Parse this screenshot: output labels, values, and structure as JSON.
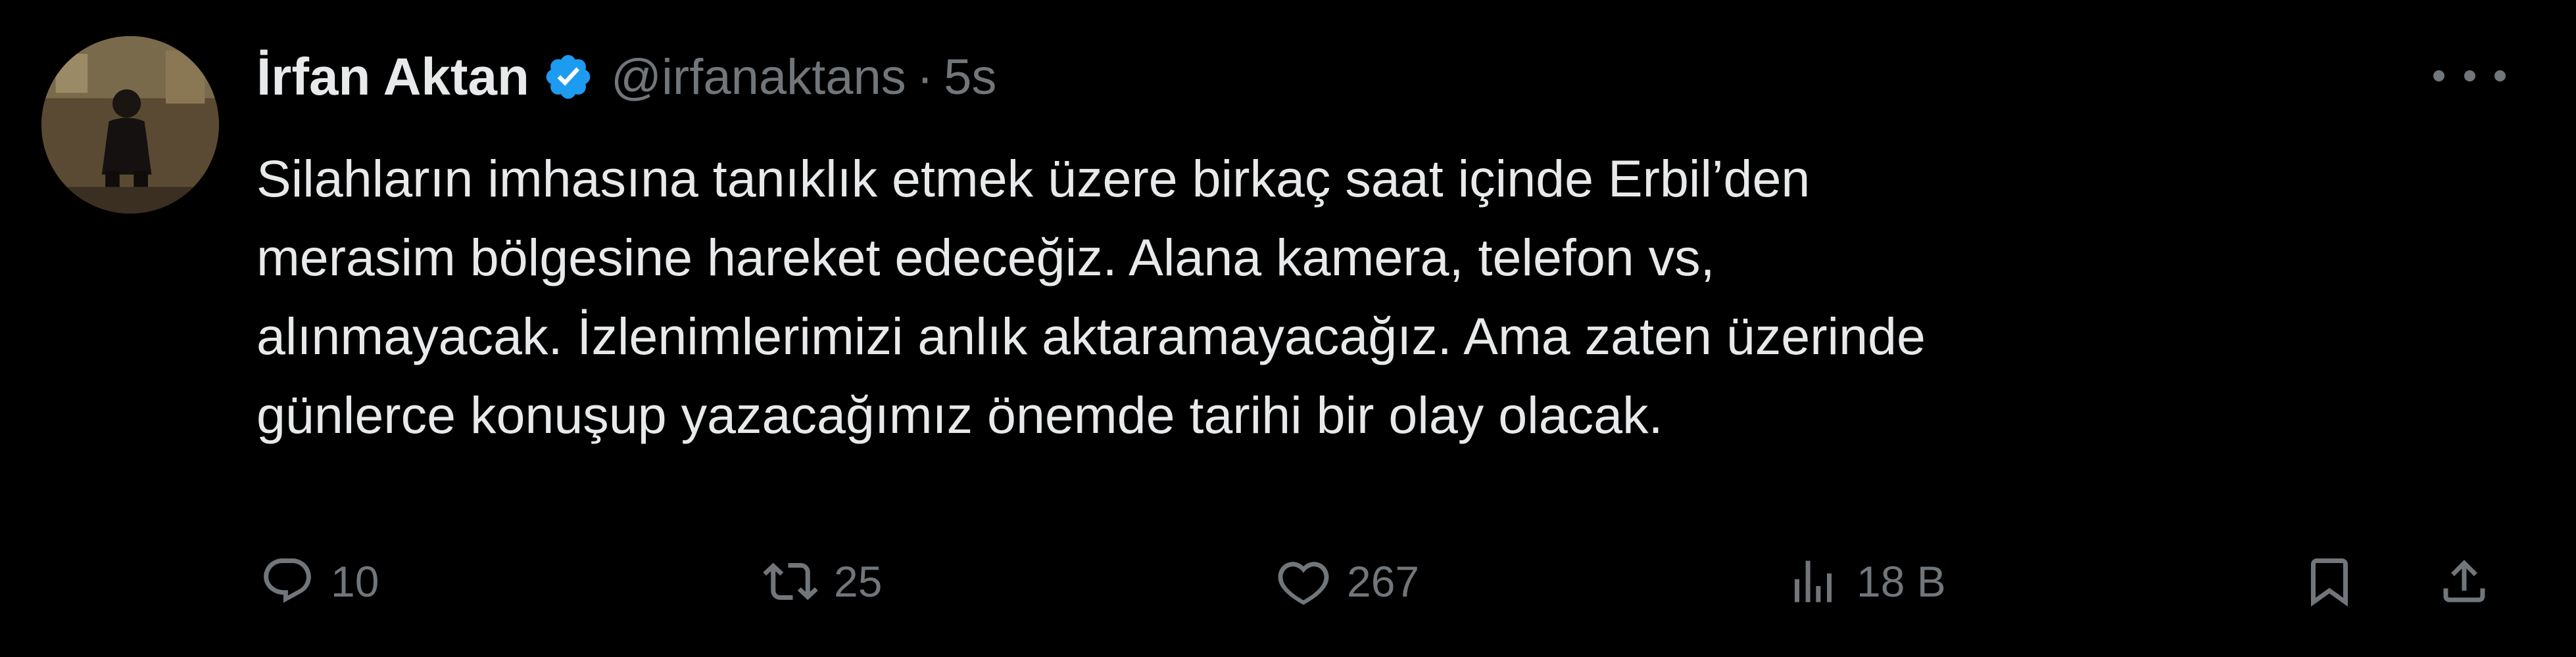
{
  "author": {
    "display_name": "İrfan Aktan",
    "handle": "@irfanaktans",
    "separator": "·",
    "time": "5s",
    "verified_color": "#1d9bf0"
  },
  "tweet": {
    "lines": [
      "Silahların imhasına tanıklık etmek üzere birkaç saat içinde Erbil’den",
      "merasim bölgesine hareket edeceğiz. Alana kamera, telefon vs,",
      "alınmayacak. İzlenimlerimizi anlık aktaramayacağız. Ama zaten üzerinde",
      "günlerce konuşup yazacağımız önemde tarihi bir olay olacak."
    ]
  },
  "actions": {
    "reply_count": "10",
    "retweet_count": "25",
    "like_count": "267",
    "views_count": "18 B",
    "icons": [
      "reply-icon",
      "retweet-icon",
      "like-icon",
      "views-icon",
      "bookmark-icon",
      "share-icon",
      "more-icon",
      "verified-icon"
    ]
  },
  "colors": {
    "background": "#000000",
    "text": "#e7e9ea",
    "muted": "#71767b"
  }
}
